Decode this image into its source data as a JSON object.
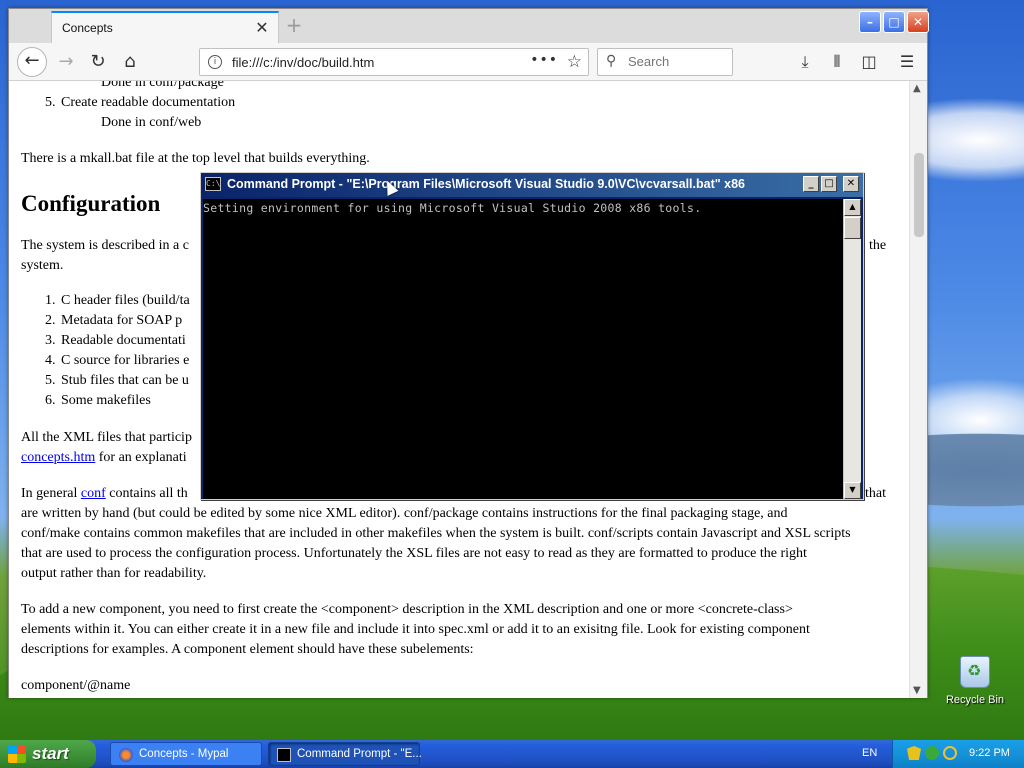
{
  "browser": {
    "tab_title": "Concepts",
    "url": "file:///c:/inv/doc/build.htm",
    "search_placeholder": "Search"
  },
  "page": {
    "partial_top_line": "Done in conf/package",
    "list_item_5": "Create readable documentation",
    "list_item_5_number": "5.",
    "list_item_5_sub": "Done in conf/web",
    "mkall_para": "There is a mkall.bat file at the top level that builds everything.",
    "heading_configuration": "Configuration",
    "system_para_start": "The system is described in a c",
    "system_para_end": "the",
    "system_para_line2": "system.",
    "config_list": [
      {
        "num": "1.",
        "text": "C header files (build/ta"
      },
      {
        "num": "2.",
        "text": "Metadata for SOAP p"
      },
      {
        "num": "3.",
        "text": "Readable documentati"
      },
      {
        "num": "4.",
        "text": "C source for libraries e"
      },
      {
        "num": "5.",
        "text": "Stub files that can be u"
      },
      {
        "num": "6.",
        "text": "Some makefiles"
      }
    ],
    "xml_para_line1": "All the XML files that particip",
    "xml_para_link": "concepts.htm",
    "xml_para_line2": "for an explanati",
    "general_para_prefix": "In general",
    "general_para_link": "conf",
    "general_para_rest": "contains all th",
    "general_para_that": "that",
    "general_para_lines": [
      "are written by hand (but could be edited by some nice XML editor). conf/package contains instructions for the final packaging stage, and",
      "conf/make contains common makefiles that are included in other makefiles when the system is built. conf/scripts contain Javascript and XSL scripts",
      "that are used to process the configuration process. Unfortunately the XSL files are not easy to read as they are formatted to produce the right",
      "output rather than for readability."
    ],
    "component_para_lines": [
      "To add a new component, you need to first create the <component> description in the XML description and one or more <concrete-class>",
      "elements within it. You can either create it in a new file and include it into spec.xml or add it to an exisitng file. Look for existing component",
      "descriptions for examples. A component element should have these subelements:"
    ],
    "component_name": "component/@name"
  },
  "cmd": {
    "title": "Command Prompt - \"E:\\Program Files\\Microsoft Visual Studio 9.0\\VC\\vcvarsall.bat\" x86",
    "output": "Setting environment for using Microsoft Visual Studio 2008 x86 tools.",
    "icon_text": "C:\\"
  },
  "desktop": {
    "recycle_bin_label": "Recycle Bin"
  },
  "taskbar": {
    "start_label": "start",
    "tasks": [
      {
        "label": "Concepts - Mypal"
      },
      {
        "label": "Command Prompt - \"E..."
      }
    ],
    "language": "EN",
    "clock": "9:22 PM"
  }
}
